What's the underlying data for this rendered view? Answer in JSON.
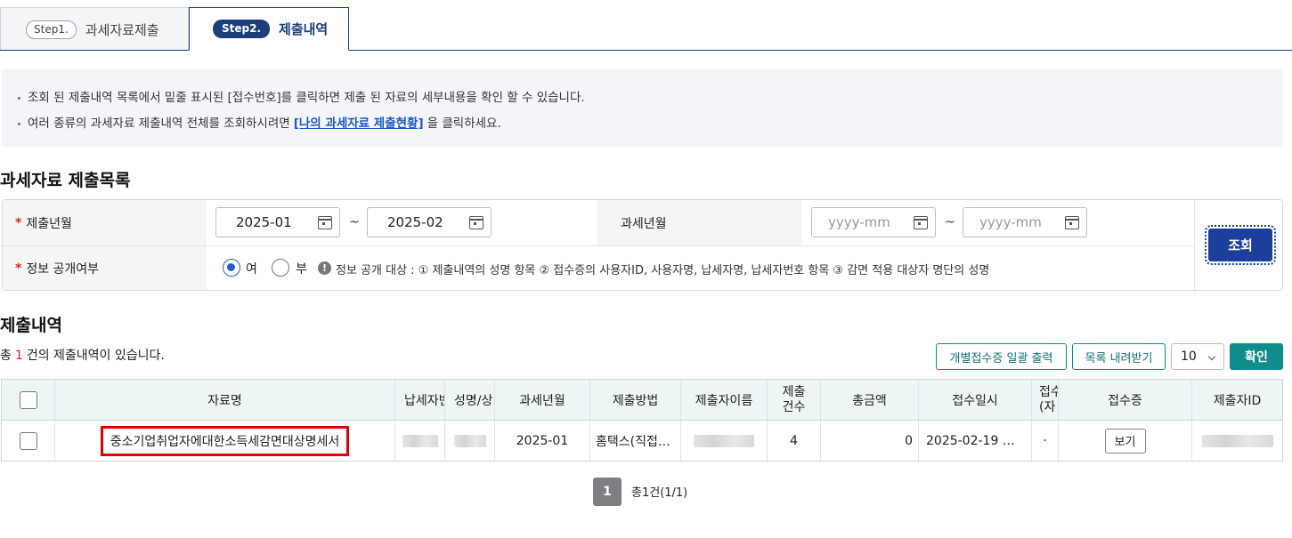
{
  "tabs": [
    {
      "step": "Step1.",
      "label": "과세자료제출"
    },
    {
      "step": "Step2.",
      "label": "제출내역"
    }
  ],
  "notice": {
    "line1": "조회 된 제출내역 목록에서 밑줄 표시된 [접수번호]를 클릭하면 제출 된 자료의 세부내용을 확인 할 수 있습니다.",
    "line2_pre": "여러 종류의 과세자료 제출내역 전체를 조회하시려면",
    "line2_link": "[나의 과세자료 제출현황]",
    "line2_post": "을 클릭하세요."
  },
  "search_section": {
    "title": "과세자료 제출목록",
    "submit_month_label": "제출년월",
    "submit_from": "2025-01",
    "submit_to": "2025-02",
    "tilde": "~",
    "tax_month_label": "과세년월",
    "tax_from_placeholder": "yyyy-mm",
    "tax_to_placeholder": "yyyy-mm",
    "disclosure_label": "정보 공개여부",
    "radio_yes": "여",
    "radio_no": "부",
    "disclosure_info": "정보 공개 대상 : ① 제출내역의 성명 항목 ② 접수증의 사용자ID, 사용자명, 납세자명, 납세자번호 항목 ③ 감면 적용 대상자 명단의 성명",
    "search_button": "조회",
    "required_mark": "*",
    "info_mark": "!"
  },
  "results": {
    "title": "제출내역",
    "total_pre": "총",
    "total_count": "1",
    "total_post": "건의 제출내역이 있습니다.",
    "btn_print": "개별접수증 일괄 출력",
    "btn_download": "목록 내려받기",
    "page_size": "10",
    "btn_ok": "확인"
  },
  "table": {
    "headers": {
      "name": "자료명",
      "taxpayer": "납세자번",
      "person": "성명/상",
      "tax_month": "과세년월",
      "method": "제출방법",
      "submitter": "제출자이름",
      "count_1": "제출",
      "count_2": "건수",
      "amount": "총금액",
      "received_at": "접수일시",
      "recno_1": "접수",
      "recno_2": "(자",
      "receipt": "접수증",
      "submitter_id": "제출자ID"
    },
    "rows": [
      {
        "name": "중소기업취업자에대한소득세감면대상명세서",
        "tax_month": "2025-01",
        "method": "홈택스(직접…",
        "count": "4",
        "amount": "0",
        "received_at": "2025-02-19 …",
        "recno": "·",
        "receipt_button": "보기"
      }
    ]
  },
  "pagination": {
    "current": "1",
    "summary": "총1건(1/1)"
  }
}
